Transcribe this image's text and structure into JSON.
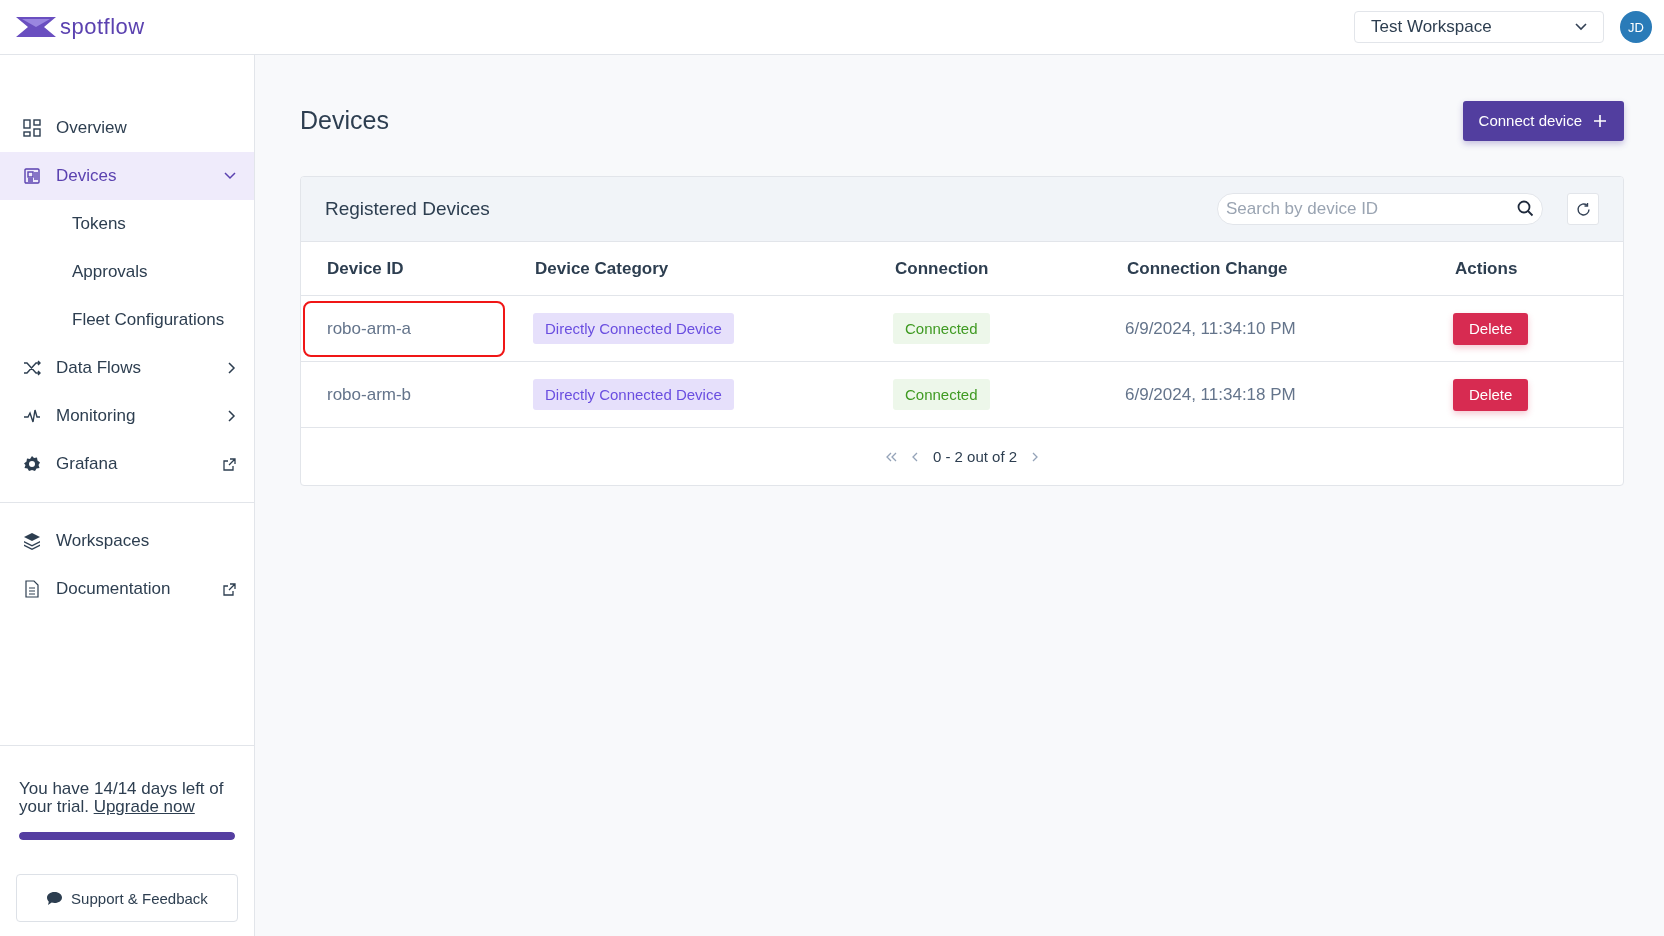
{
  "brand": {
    "name": "spotflow"
  },
  "workspace_select": {
    "value": "Test Workspace"
  },
  "user": {
    "initials": "JD"
  },
  "sidebar": {
    "items": [
      {
        "label": "Overview",
        "kind": "page",
        "selected": false
      },
      {
        "label": "Devices",
        "kind": "group",
        "expanded": true,
        "selected": true,
        "children": [
          {
            "label": "Tokens"
          },
          {
            "label": "Approvals"
          },
          {
            "label": "Fleet Configurations"
          }
        ]
      },
      {
        "label": "Data Flows",
        "kind": "group",
        "expanded": false,
        "selected": false
      },
      {
        "label": "Monitoring",
        "kind": "group",
        "expanded": false,
        "selected": false
      },
      {
        "label": "Grafana",
        "kind": "external",
        "selected": false
      }
    ],
    "secondary_items": [
      {
        "label": "Workspaces",
        "kind": "page",
        "selected": false
      },
      {
        "label": "Documentation",
        "kind": "external",
        "selected": false
      }
    ],
    "trial": {
      "text": "You have 14/14 days left of your trial.",
      "link": "Upgrade now",
      "level": 1.0
    },
    "support_button": "Support & Feedback"
  },
  "page": {
    "title": "Devices",
    "primary_button": "Connect device"
  },
  "card": {
    "title": "Registered Devices",
    "search": {
      "placeholder": "Search by device ID"
    },
    "columns": [
      "Device ID",
      "Device Category",
      "Connection",
      "Connection Change",
      "Actions"
    ],
    "rows": [
      {
        "device_id": "robo-arm-a",
        "category": "Directly Connected Device",
        "connection": "Connected",
        "connection_change": "6/9/2024, 11:34:10 PM",
        "action": "Delete",
        "highlighted": true
      },
      {
        "device_id": "robo-arm-b",
        "category": "Directly Connected Device",
        "connection": "Connected",
        "connection_change": "6/9/2024, 11:34:18 PM",
        "action": "Delete",
        "highlighted": false
      }
    ],
    "pagination": "0 - 2 out of 2"
  }
}
